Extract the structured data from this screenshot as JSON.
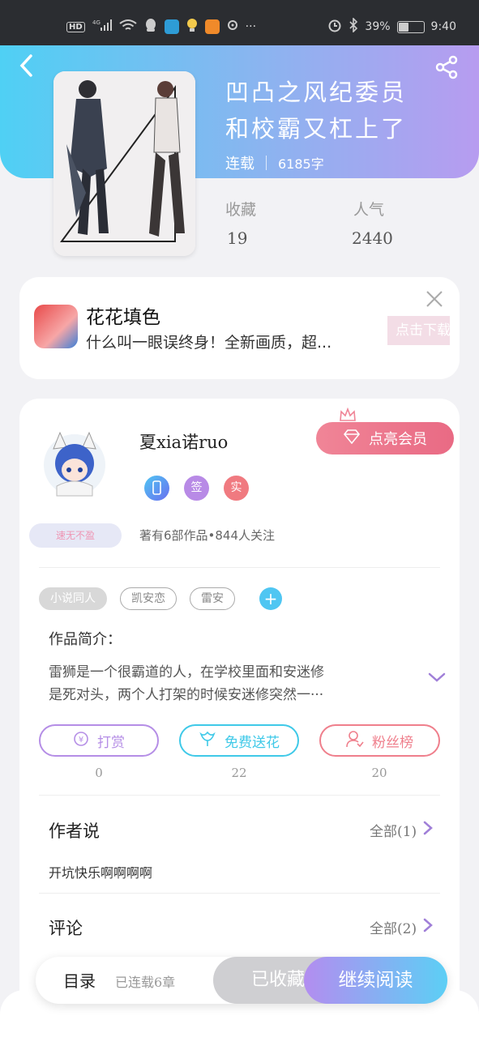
{
  "status_bar": {
    "hd": "HD",
    "signal": "4G",
    "battery": "39%",
    "battery_level": 0.39,
    "time": "9:40",
    "more": "···"
  },
  "book": {
    "title_line1": "凹凸之风纪委员",
    "title_line2": "和校霸又杠上了",
    "status": "连载",
    "word_count": "6185字",
    "collect_label": "收藏",
    "collect_value": "19",
    "popularity_label": "人气",
    "popularity_value": "2440"
  },
  "ad": {
    "app_name": "花花填色",
    "description": "什么叫一眼误终身！全新画质，超...",
    "button": "点击下载"
  },
  "author": {
    "name": "夏xia诺ruo",
    "vip_button": "点亮会员",
    "badges": [
      "签",
      "实"
    ],
    "nickname_tag": "速无不盈",
    "works_info": "著有6部作品•844人关注"
  },
  "tags": [
    "小说同人",
    "凯安恋",
    "雷安"
  ],
  "intro": {
    "label": "作品简介：",
    "text_line1": "雷狮是一个很霸道的人，在学校里面和安迷修",
    "text_line2": "是死对头，两个人打架的时候安迷修突然一···"
  },
  "actions": [
    {
      "label": "打赏",
      "count": "0",
      "color": "#b58ee6"
    },
    {
      "label": "免费送花",
      "count": "22",
      "color": "#3fc9e8"
    },
    {
      "label": "粉丝榜",
      "count": "20",
      "color": "#ef7f8c"
    }
  ],
  "author_says": {
    "title": "作者说",
    "more": "全部(1)",
    "content": "开坑快乐啊啊啊啊"
  },
  "comments": {
    "title": "评论",
    "more": "全部(2)"
  },
  "bottom_bar": {
    "toc": "目录",
    "serial": "已连载6章",
    "collected": "已收藏",
    "read": "继续阅读"
  }
}
